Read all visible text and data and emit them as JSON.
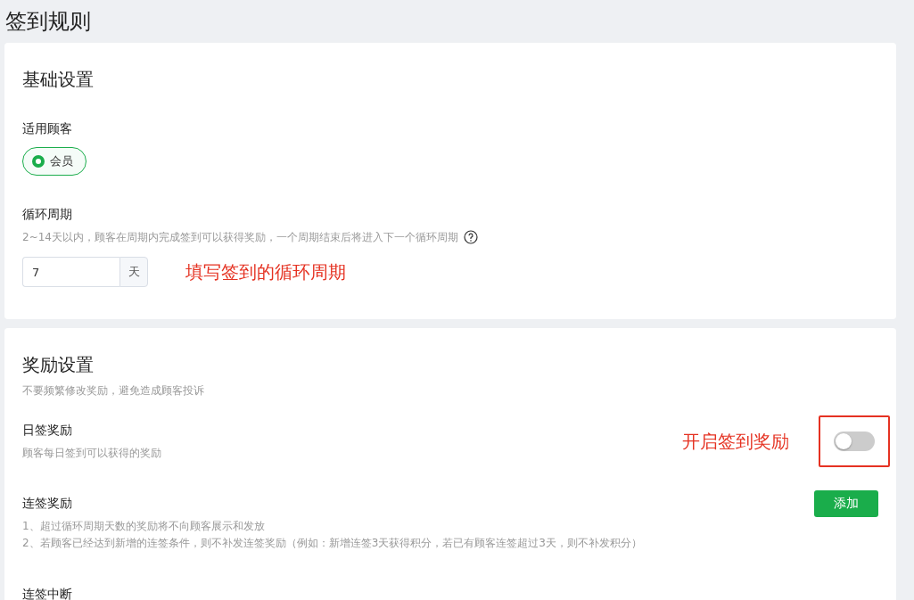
{
  "page_title": "签到规则",
  "basic_settings": {
    "title": "基础设置",
    "customer": {
      "label": "适用顾客",
      "options": [
        {
          "label": "会员",
          "selected": true
        }
      ]
    },
    "cycle": {
      "label": "循环周期",
      "hint": "2~14天以内，顾客在周期内完成签到可以获得奖励，一个周期结束后将进入下一个循环周期",
      "value": "7",
      "unit": "天",
      "annotation": "填写签到的循环周期"
    }
  },
  "reward_settings": {
    "title": "奖励设置",
    "subtitle": "不要频繁修改奖励，避免造成顾客投诉",
    "daily": {
      "label": "日签奖励",
      "description": "顾客每日签到可以获得的奖励",
      "on": false,
      "annotation": "开启签到奖励"
    },
    "streak": {
      "label": "连签奖励",
      "notes": [
        "1、超过循环周期天数的奖励将不向顾客展示和发放",
        "2、若顾客已经达到新增的连签条件，则不补发连签奖励（例如：新增连签3天获得积分，若已有顾客连签超过3天，则不补发积分）"
      ],
      "button": "添加"
    },
    "break": {
      "label": "连签中断"
    }
  }
}
